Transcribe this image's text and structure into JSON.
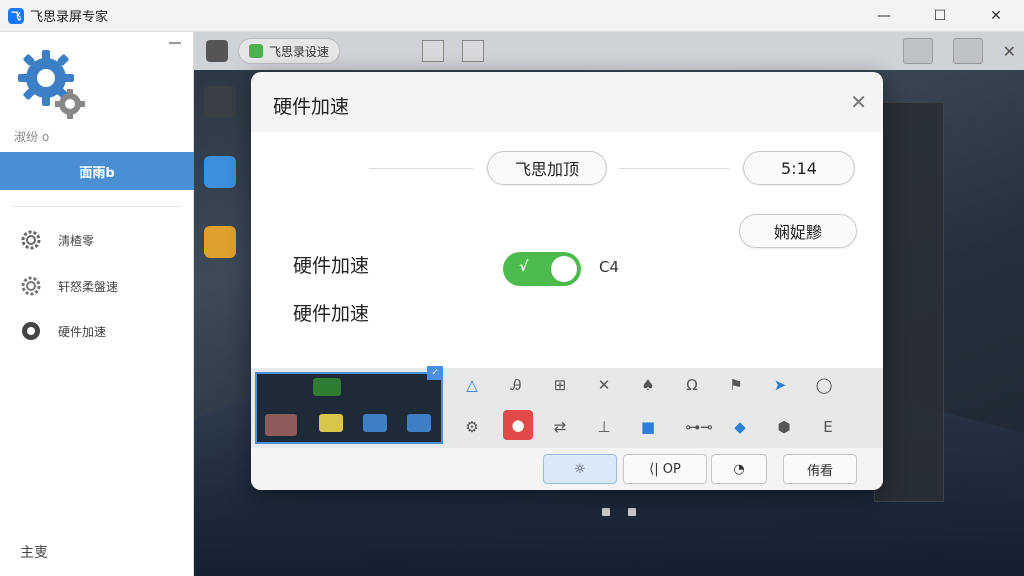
{
  "window": {
    "title": "飞思录屏专家",
    "minimize_glyph": "—",
    "maximize_glyph": "☐",
    "close_glyph": "✕"
  },
  "sidebar": {
    "user_label": "淑纷 o",
    "active_label": "面雨b",
    "items": [
      {
        "label": "淸楂零",
        "icon": "gear-icon"
      },
      {
        "label": "轩怒柔盤速",
        "icon": "gear-icon"
      },
      {
        "label": "硬件加速",
        "icon": "gear-icon"
      }
    ],
    "footer_label": "主叓"
  },
  "main": {
    "toolbar_tab_label": "飞思录设速"
  },
  "dialog": {
    "title": "硬件加速",
    "close_glyph": "✕",
    "center_pill": "飞思加顶",
    "right_pill": "5:14",
    "right_pill_2": "娴娖黲",
    "row1_label": "硬件加速",
    "row2_label": "硬件加速",
    "toggle_state": true,
    "toggle_check": "√",
    "toggle_text": "C4",
    "footer_buttons": [
      {
        "label": "☼",
        "primary": true
      },
      {
        "label": "⟨|  OP",
        "primary": false
      },
      {
        "label": "◔",
        "primary": false
      },
      {
        "label": "侑看",
        "primary": false
      }
    ]
  },
  "colors": {
    "accent": "#4a8fd4",
    "toggle_on": "#4cbb4c",
    "selection": "#4a90e2"
  }
}
